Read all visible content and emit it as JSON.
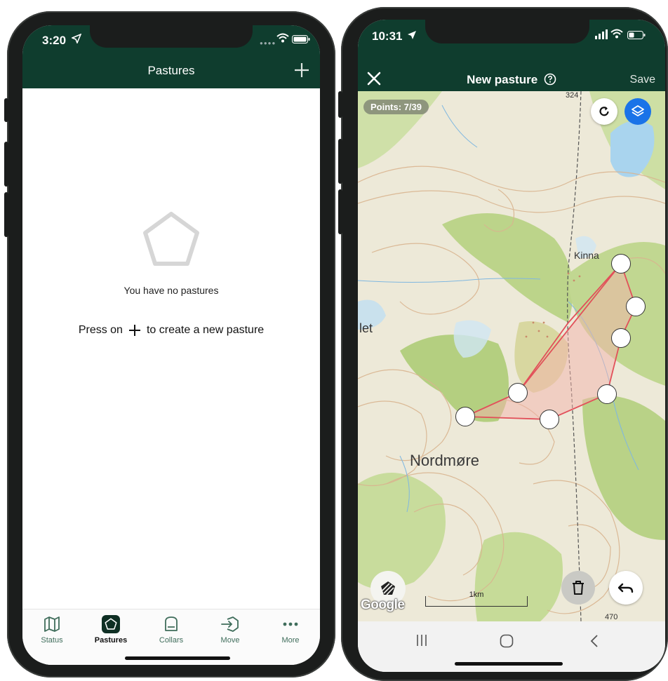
{
  "left": {
    "status_time": "3:20",
    "nav_title": "Pastures",
    "empty_message": "You have no pastures",
    "press_prefix": "Press on",
    "press_suffix": "to create a new pasture",
    "tabs": [
      {
        "label": "Status",
        "icon": "map-icon"
      },
      {
        "label": "Pastures",
        "icon": "pentagon-icon",
        "active": true
      },
      {
        "label": "Collars",
        "icon": "collar-icon"
      },
      {
        "label": "Move",
        "icon": "move-icon"
      },
      {
        "label": "More",
        "icon": "more-icon"
      }
    ],
    "colors": {
      "header": "#0f3d2e",
      "tab_text": "#3f6d5b"
    }
  },
  "right": {
    "status_time": "10:31",
    "nav_title": "New pasture",
    "save_label": "Save",
    "points_label": "Points: 7/39",
    "map_labels": {
      "place_kinna": "Kinna",
      "region_nordmore": "Nordmøre",
      "partial_let": "let",
      "elevation_324": "324",
      "elevation_470": "470"
    },
    "scale_label": "1km",
    "google_logo": "Google",
    "colors": {
      "polygon_stroke": "#e2505a",
      "layers_button": "#1a73e8"
    }
  }
}
